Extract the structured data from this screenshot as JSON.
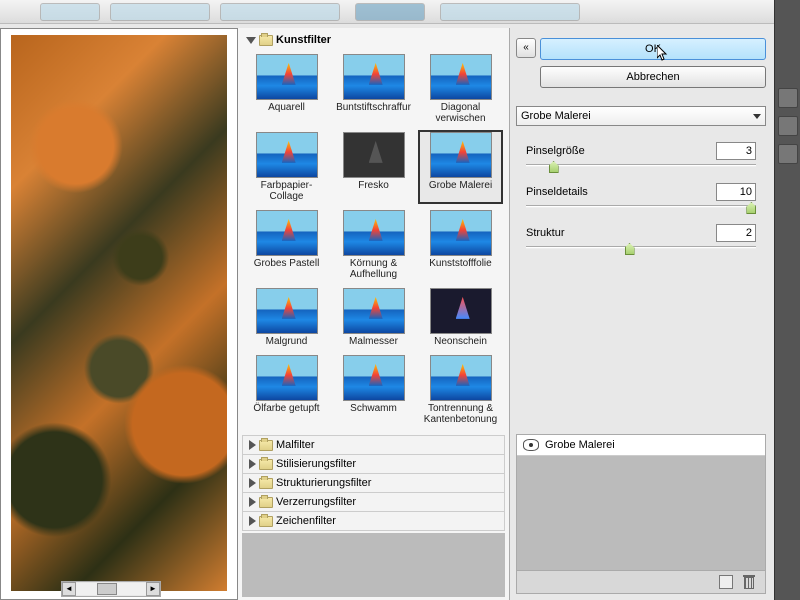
{
  "buttons": {
    "ok": "OK",
    "cancel": "Abbrechen"
  },
  "activeFilterDropdown": "Grobe Malerei",
  "params": [
    {
      "label": "Pinselgröße",
      "value": "3",
      "pos": 12
    },
    {
      "label": "Pinseldetails",
      "value": "10",
      "pos": 98
    },
    {
      "label": "Struktur",
      "value": "2",
      "pos": 45
    }
  ],
  "effectRow": "Grobe Malerei",
  "categories": {
    "open": "Kunstfilter",
    "collapsed": [
      "Malfilter",
      "Stilisierungsfilter",
      "Strukturierungsfilter",
      "Verzerrungsfilter",
      "Zeichenfilter"
    ]
  },
  "filters": [
    {
      "label": "Aquarell"
    },
    {
      "label": "Buntstiftschraffur"
    },
    {
      "label": "Diagonal verwischen"
    },
    {
      "label": "Farbpapier-Collage"
    },
    {
      "label": "Fresko",
      "variant": "dark"
    },
    {
      "label": "Grobe Malerei",
      "selected": true
    },
    {
      "label": "Grobes Pastell"
    },
    {
      "label": "Körnung & Aufhellung"
    },
    {
      "label": "Kunststofffolie"
    },
    {
      "label": "Malgrund"
    },
    {
      "label": "Malmesser"
    },
    {
      "label": "Neonschein",
      "variant": "neon"
    },
    {
      "label": "Ölfarbe getupft"
    },
    {
      "label": "Schwamm"
    },
    {
      "label": "Tontrennung & Kantenbetonung"
    }
  ]
}
